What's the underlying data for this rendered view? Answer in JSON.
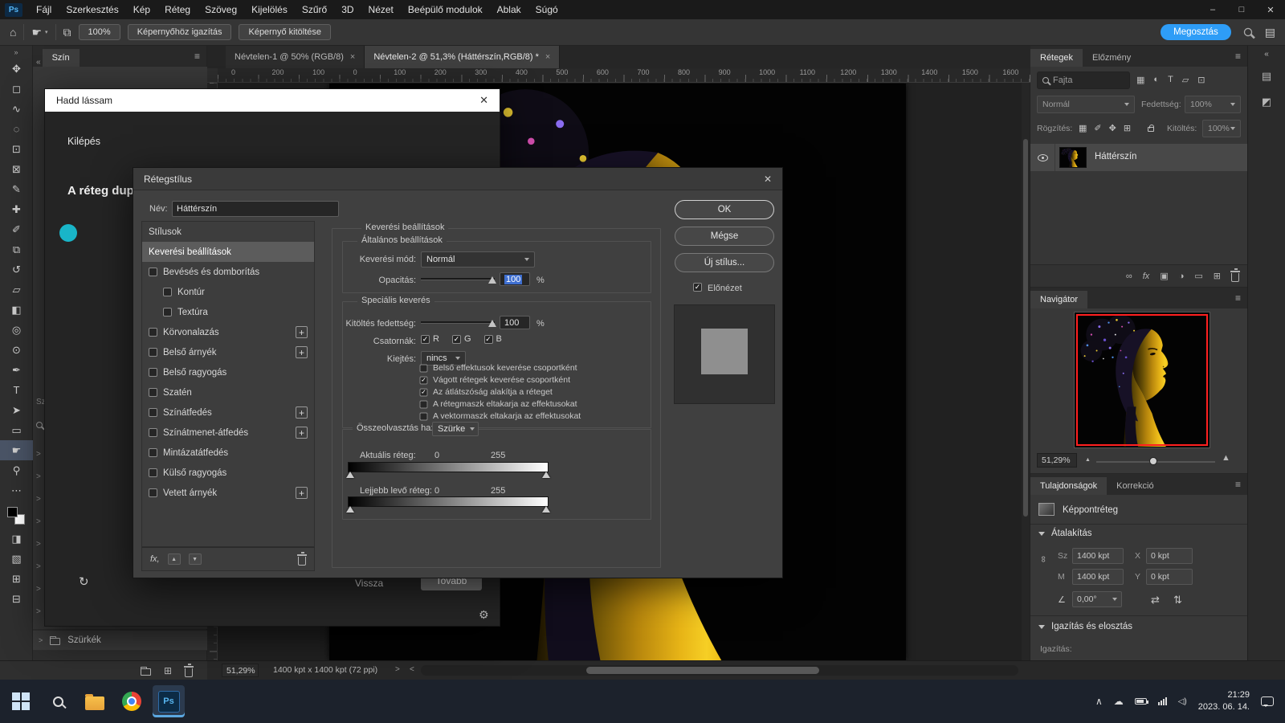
{
  "menu_bar": {
    "logo": "Ps",
    "items": [
      "Fájl",
      "Szerkesztés",
      "Kép",
      "Réteg",
      "Szöveg",
      "Kijelölés",
      "Szűrő",
      "3D",
      "Nézet",
      "Beépülő modulok",
      "Ablak",
      "Súgó"
    ],
    "window": {
      "minimize": "–",
      "maximize": "□",
      "close": "✕"
    }
  },
  "options_bar": {
    "icons": {
      "home": "⌂",
      "hand": "☛",
      "arrange": "⧉",
      "workspace": "▤"
    },
    "zoom_button": "100%",
    "fit_screen_button": "Képernyőhöz igazítás",
    "fill_screen_button": "Képernyő kitöltése",
    "share_button": "Megosztás"
  },
  "document_tabs": [
    {
      "label": "Névtelen-1 @ 50% (RGB/8)",
      "close": "×",
      "active": false
    },
    {
      "label": "Névtelen-2 @ 51,3% (Háttérszín,RGB/8) *",
      "close": "×",
      "active": true
    }
  ],
  "ruler_labels": [
    "0",
    "200",
    "100",
    "0",
    "100",
    "200",
    "300",
    "400",
    "500",
    "600",
    "700",
    "800",
    "900",
    "1000",
    "1100",
    "1200",
    "1300",
    "1400",
    "1500",
    "1600"
  ],
  "toolbar": {
    "expand_chevron": "»",
    "tools": [
      {
        "glyph": "✥",
        "name": "move-tool"
      },
      {
        "glyph": "◻",
        "name": "marquee-tool"
      },
      {
        "glyph": "∿",
        "name": "lasso-tool"
      },
      {
        "glyph": "◌",
        "name": "object-selection-tool"
      },
      {
        "glyph": "⊡",
        "name": "crop-tool"
      },
      {
        "glyph": "⊠",
        "name": "frame-tool"
      },
      {
        "glyph": "✎",
        "name": "eyedropper-tool"
      },
      {
        "glyph": "✚",
        "name": "healing-brush-tool"
      },
      {
        "glyph": "✐",
        "name": "brush-tool"
      },
      {
        "glyph": "⧉",
        "name": "clone-stamp-tool"
      },
      {
        "glyph": "↺",
        "name": "history-brush-tool"
      },
      {
        "glyph": "▱",
        "name": "eraser-tool"
      },
      {
        "glyph": "◧",
        "name": "gradient-tool"
      },
      {
        "glyph": "◎",
        "name": "blur-tool"
      },
      {
        "glyph": "⊙",
        "name": "dodge-tool"
      },
      {
        "glyph": "✒",
        "name": "pen-tool"
      },
      {
        "glyph": "T",
        "name": "type-tool"
      },
      {
        "glyph": "➤",
        "name": "path-selection-tool"
      },
      {
        "glyph": "▭",
        "name": "shape-tool"
      },
      {
        "glyph": "☛",
        "name": "hand-tool",
        "selected": true
      },
      {
        "glyph": "⚲",
        "name": "zoom-tool"
      }
    ],
    "more_icon": "⋯",
    "extras": [
      {
        "glyph": "◨",
        "name": "quick-mask-icon"
      },
      {
        "glyph": "▧",
        "name": "screen-mode-icon"
      },
      {
        "glyph": "⊞",
        "name": "dock-icon-1"
      },
      {
        "glyph": "⊟",
        "name": "dock-icon-2"
      }
    ]
  },
  "left_dock": {
    "collapse_chevron": "«",
    "panel_tab": "Szín",
    "sliver_label": "Sz",
    "group_row": "Szürkék",
    "row_chevron": ">"
  },
  "lets_see_dialog": {
    "title": "Hadd lássam",
    "close": "✕",
    "exit_label": "Kilépés",
    "heading": "A réteg dupli",
    "restart_icon": "↻",
    "back_button": "Vissza",
    "next_button": "Tovább",
    "settings_icon": "⚙"
  },
  "layer_style_dialog": {
    "title": "Rétegstílus",
    "close": "✕",
    "name_label": "Név:",
    "name_value": "Háttérszín",
    "styles_list": [
      {
        "label": "Stílusok"
      },
      {
        "label": "Keverési beállítások",
        "selected": true
      },
      {
        "label": "Bevésés és domborítás",
        "checkbox": true
      },
      {
        "label": "Kontúr",
        "checkbox": true,
        "indent": true
      },
      {
        "label": "Textúra",
        "checkbox": true,
        "indent": true
      },
      {
        "label": "Körvonalazás",
        "checkbox": true,
        "plus": true
      },
      {
        "label": "Belső árnyék",
        "checkbox": true,
        "plus": true
      },
      {
        "label": "Belső ragyogás",
        "checkbox": true
      },
      {
        "label": "Szatén",
        "checkbox": true
      },
      {
        "label": "Színátfedés",
        "checkbox": true,
        "plus": true
      },
      {
        "label": "Színátmenet-átfedés",
        "checkbox": true,
        "plus": true
      },
      {
        "label": "Mintázatátfedés",
        "checkbox": true
      },
      {
        "label": "Külső ragyogás",
        "checkbox": true
      },
      {
        "label": "Vetett árnyék",
        "checkbox": true,
        "plus": true
      }
    ],
    "list_footer": {
      "fx": "fx,",
      "up": "▲",
      "down": "▼"
    },
    "outer_group": "Keverési beállítások",
    "general": {
      "legend": "Általános beállítások",
      "blend_mode_label": "Keverési mód:",
      "blend_mode_value": "Normál",
      "opacity_label": "Opacitás:",
      "opacity_value": "100",
      "unit": "%"
    },
    "advanced": {
      "legend": "Speciális keverés",
      "fill_opacity_label": "Kitöltés fedettség:",
      "fill_opacity_value": "100",
      "unit": "%",
      "channels_label": "Csatornák:",
      "channels": [
        {
          "label": "R",
          "checked": true
        },
        {
          "label": "G",
          "checked": true
        },
        {
          "label": "B",
          "checked": true
        }
      ],
      "knockout_label": "Kiejtés:",
      "knockout_value": "nincs",
      "options": [
        {
          "label": "Belső effektusok keverése csoportként",
          "checked": false
        },
        {
          "label": "Vágott rétegek keverése csoportként",
          "checked": true
        },
        {
          "label": "Az átlátszóság alakítja a réteget",
          "checked": true
        },
        {
          "label": "A rétegmaszk eltakarja az effektusokat",
          "checked": false
        },
        {
          "label": "A vektormaszk eltakarja az effektusokat",
          "checked": false
        }
      ]
    },
    "blend_if": {
      "legend": "Összeolvasztás ha:",
      "mode_value": "Szürke",
      "current_layer_label": "Aktuális réteg:",
      "current_min": "0",
      "current_max": "255",
      "below_layer_label": "Lejjebb levő réteg:",
      "below_min": "0",
      "below_max": "255"
    },
    "ok_button": "OK",
    "cancel_button": "Mégse",
    "new_style_button": "Új stílus...",
    "preview_label": "Előnézet"
  },
  "layers_panel": {
    "tabs": [
      {
        "label": "Rétegek",
        "active": true
      },
      {
        "label": "Előzmény",
        "active": false
      }
    ],
    "filter_label": "Fajta",
    "filter_icons": [
      {
        "glyph": "▦",
        "name": "filter-pixel-layers-icon"
      },
      {
        "glyph": "◐",
        "name": "filter-adjustment-layers-icon"
      },
      {
        "glyph": "T",
        "name": "filter-type-layers-icon"
      },
      {
        "glyph": "▱",
        "name": "filter-shape-layers-icon"
      },
      {
        "glyph": "⊡",
        "name": "filter-smart-objects-icon"
      }
    ],
    "blend_mode": "Normál",
    "opacity_label": "Fedettség:",
    "opacity_value": "100%",
    "lock_label": "Rögzítés:",
    "lock_icons": [
      {
        "glyph": "▦",
        "name": "lock-transparency-icon"
      },
      {
        "glyph": "✐",
        "name": "lock-pixels-icon"
      },
      {
        "glyph": "✥",
        "name": "lock-position-icon"
      },
      {
        "glyph": "⊞",
        "name": "lock-artboard-icon"
      }
    ],
    "fill_label": "Kitöltés:",
    "fill_value": "100%",
    "layer_name": "Háttérszín",
    "bottom_icons": {
      "link": "∞",
      "fx": "fx",
      "mask": "▣",
      "adjust": "◑",
      "group": "▭",
      "new": "⊞"
    }
  },
  "navigator_panel": {
    "tab": "Navigátor",
    "zoom_value": "51,29%",
    "small_icon": "▲",
    "large_icon": "▲"
  },
  "properties_panel": {
    "tabs": [
      {
        "label": "Tulajdonságok",
        "active": true
      },
      {
        "label": "Korrekció",
        "active": false
      }
    ],
    "layer_type": "Képpontréteg",
    "transform_section": "Átalakítás",
    "icons": {
      "link": "∞",
      "angle": "∠",
      "flip_h": "⇄",
      "flip_v": "⇅"
    },
    "w_label": "Sz",
    "w_value": "1400 kpt",
    "x_label": "X",
    "x_value": "0 kpt",
    "h_label": "M",
    "h_value": "1400 kpt",
    "y_label": "Y",
    "y_value": "0 kpt",
    "angle_value": "0,00°",
    "align_section": "Igazítás és elosztás",
    "align_label": "Igazítás:"
  },
  "right_strip": {
    "collapse": "«",
    "icons": [
      {
        "glyph": "▤",
        "name": "collapsed-panel-icon-1"
      },
      {
        "glyph": "◩",
        "name": "collapsed-panel-icon-2"
      }
    ]
  },
  "status_bar": {
    "zoom_value": "51,29%",
    "doc_info": "1400 kpt x 1400 kpt (72 ppi)",
    "chevron_right": ">",
    "chevron_left": "<",
    "new_icon": "⊞"
  },
  "taskbar": {
    "ps_label": "Ps",
    "tray": {
      "chevron": "∧",
      "cloud": "☁",
      "volume": "◁)"
    },
    "time": "21:29",
    "date": "2023. 06. 14."
  }
}
